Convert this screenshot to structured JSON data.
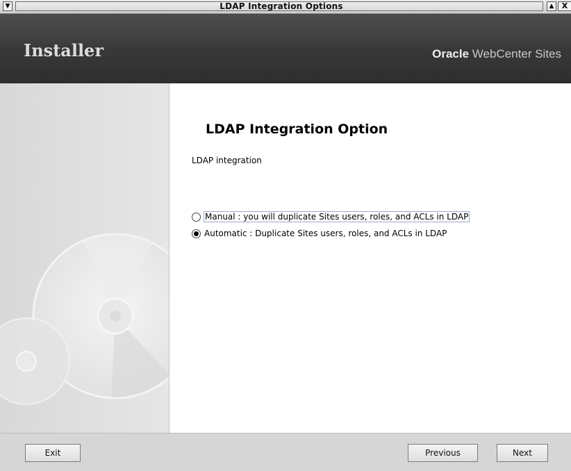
{
  "window": {
    "title": "LDAP Integration Options",
    "menu_glyph": "▼",
    "maximize_glyph": "▲",
    "close_glyph": "X"
  },
  "header": {
    "app_title": "Installer",
    "brand_bold": "Oracle",
    "brand_rest": " WebCenter Sites"
  },
  "content": {
    "heading": "LDAP Integration Option",
    "subtext": "LDAP integration",
    "options": [
      {
        "label": "Manual : you will duplicate Sites users, roles, and ACLs in LDAP",
        "selected": false
      },
      {
        "label": "Automatic : Duplicate Sites users, roles, and ACLs in LDAP",
        "selected": true
      }
    ]
  },
  "footer": {
    "exit_label": "Exit",
    "previous_label": "Previous",
    "next_label": "Next"
  },
  "colors": {
    "header_bg": "#3b3b3b",
    "side_panel_bg": "#e0e0e0",
    "content_bg": "#ffffff"
  }
}
